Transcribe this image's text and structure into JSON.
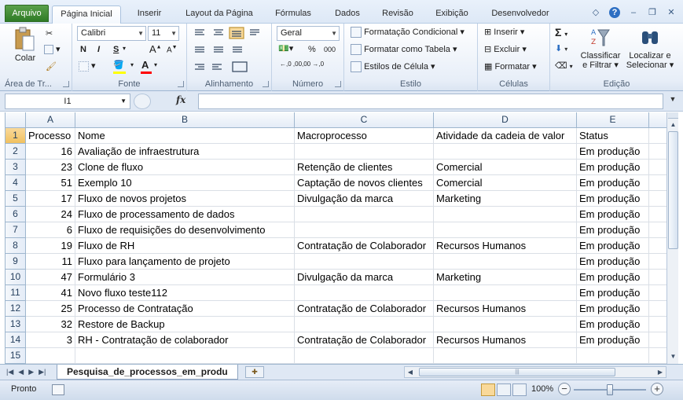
{
  "ribbon_tabs": {
    "file": "Arquivo",
    "home": "Página Inicial",
    "insert": "Inserir",
    "page_layout": "Layout da Página",
    "formulas": "Fórmulas",
    "data": "Dados",
    "review": "Revisão",
    "view": "Exibição",
    "developer": "Desenvolvedor"
  },
  "clipboard": {
    "paste": "Colar",
    "label": "Área de Tr..."
  },
  "font": {
    "name": "Calibri",
    "size": "11",
    "bold": "N",
    "italic": "I",
    "underline": "S",
    "grow": "A",
    "shrink": "A",
    "label": "Fonte",
    "fill_color": "#ffff00",
    "font_color": "#ff0000"
  },
  "alignment": {
    "label": "Alinhamento"
  },
  "number": {
    "format": "Geral",
    "percent": "%",
    "thousands": "000",
    "increase_decimal": "←,0 ,00",
    "decrease_decimal": ",00 →,0",
    "label": "Número"
  },
  "styles": {
    "conditional": "Formatação Condicional",
    "table": "Formatar como Tabela",
    "cell": "Estilos de Célula",
    "label": "Estilo"
  },
  "cells": {
    "insert": "Inserir",
    "delete": "Excluir",
    "format": "Formatar",
    "label": "Células"
  },
  "editing": {
    "sort_line1": "Classificar",
    "sort_line2": "e Filtrar",
    "find_line1": "Localizar e",
    "find_line2": "Selecionar",
    "label": "Edição"
  },
  "formula_bar": {
    "name_box": "I1",
    "fx": "fx",
    "formula": ""
  },
  "sheet": {
    "columns": [
      "A",
      "B",
      "C",
      "D",
      "E"
    ],
    "selected_row": "1",
    "rows": [
      {
        "n": "1",
        "a": "Processo",
        "b": "Nome",
        "c": "Macroprocesso",
        "d": "Atividade da cadeia de valor",
        "e": "Status"
      },
      {
        "n": "2",
        "a": "16",
        "b": "Avaliação de infraestrutura",
        "c": "",
        "d": "",
        "e": "Em produção"
      },
      {
        "n": "3",
        "a": "23",
        "b": "Clone de fluxo",
        "c": "Retenção de clientes",
        "d": "Comercial",
        "e": "Em produção"
      },
      {
        "n": "4",
        "a": "51",
        "b": "Exemplo 10",
        "c": "Captação de novos clientes",
        "d": "Comercial",
        "e": "Em produção"
      },
      {
        "n": "5",
        "a": "17",
        "b": "Fluxo de novos projetos",
        "c": "Divulgação da marca",
        "d": "Marketing",
        "e": "Em produção"
      },
      {
        "n": "6",
        "a": "24",
        "b": "Fluxo de processamento de dados",
        "c": "",
        "d": "",
        "e": "Em produção"
      },
      {
        "n": "7",
        "a": "6",
        "b": "Fluxo de requisições do desenvolvimento",
        "c": "",
        "d": "",
        "e": "Em produção"
      },
      {
        "n": "8",
        "a": "19",
        "b": "Fluxo de RH",
        "c": "Contratação de Colaborador",
        "d": "Recursos Humanos",
        "e": "Em produção"
      },
      {
        "n": "9",
        "a": "11",
        "b": "Fluxo para lançamento de projeto",
        "c": "",
        "d": "",
        "e": "Em produção"
      },
      {
        "n": "10",
        "a": "47",
        "b": "Formulário 3",
        "c": "Divulgação da marca",
        "d": "Marketing",
        "e": "Em produção"
      },
      {
        "n": "11",
        "a": "41",
        "b": "Novo fluxo teste112",
        "c": "",
        "d": "",
        "e": "Em produção"
      },
      {
        "n": "12",
        "a": "25",
        "b": "Processo de Contratação",
        "c": "Contratação de Colaborador",
        "d": "Recursos Humanos",
        "e": "Em produção"
      },
      {
        "n": "13",
        "a": "32",
        "b": "Restore de Backup",
        "c": "",
        "d": "",
        "e": "Em produção"
      },
      {
        "n": "14",
        "a": "3",
        "b": "RH - Contratação de colaborador",
        "c": "Contratação de Colaborador",
        "d": "Recursos Humanos",
        "e": "Em produção"
      },
      {
        "n": "15",
        "a": "",
        "b": "",
        "c": "",
        "d": "",
        "e": ""
      }
    ]
  },
  "sheet_tabs": {
    "active": "Pesquisa_de_processos_em_produ"
  },
  "status_bar": {
    "mode": "Pronto",
    "zoom": "100%"
  }
}
